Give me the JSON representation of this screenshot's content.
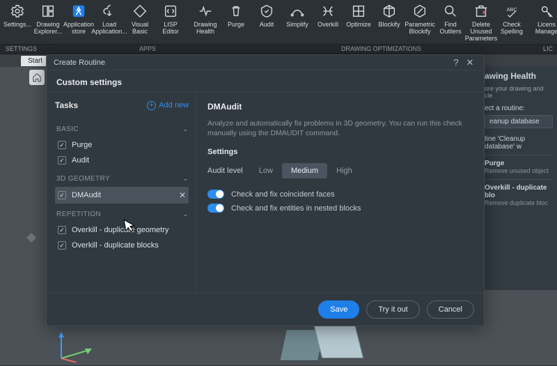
{
  "ribbon": {
    "items": [
      {
        "label": "Settings...",
        "icon": "gear"
      },
      {
        "label": "Drawing\nExplorer...",
        "icon": "explorer"
      },
      {
        "label": "Application\nstore",
        "icon": "appstore",
        "accent": "#1f7fe8"
      },
      {
        "label": "Load\nApplication...",
        "icon": "load"
      },
      {
        "label": "Visual\nBasic",
        "icon": "vba"
      },
      {
        "label": "LISP\nEditor",
        "icon": "lisp"
      },
      {
        "label": "Drawing\nHealth",
        "icon": "health"
      },
      {
        "label": "Purge",
        "icon": "purge"
      },
      {
        "label": "Audit",
        "icon": "audit"
      },
      {
        "label": "Simplify",
        "icon": "simplify"
      },
      {
        "label": "Overkill",
        "icon": "overkill"
      },
      {
        "label": "Optimize",
        "icon": "optimize"
      },
      {
        "label": "Blockify",
        "icon": "blockify"
      },
      {
        "label": "Parametric\nBlockify",
        "icon": "pblockify"
      },
      {
        "label": "Find\nOutliers",
        "icon": "outliers"
      },
      {
        "label": "Delete Unused\nParameters",
        "icon": "deleteparams"
      },
      {
        "label": "Check\nSpelling",
        "icon": "spell"
      },
      {
        "label": "Licens\nManage",
        "icon": "license"
      }
    ],
    "groups": {
      "settings": "SETTINGS",
      "apps": "APPS",
      "draw": "DRAWING OPTIMIZATIONS",
      "lic": "LIC"
    }
  },
  "tabs": {
    "start": "Start"
  },
  "rpanel": {
    "title": "awing Health",
    "sub": "ore your drawing and cle",
    "label": "ect a routine:",
    "combo": "eanup database",
    "routine": "tine 'Cleanup database' w",
    "sec1_title": "Purge",
    "sec1_sub": "Remove unused object",
    "sec2_title": "Overkill - duplicate blo",
    "sec2_sub": "Remove duplicate bloc"
  },
  "dialog": {
    "title": "Create Routine",
    "subtitle": "Custom settings",
    "tasks_title": "Tasks",
    "add_new": "Add new",
    "groups": {
      "basic": "BASIC",
      "geom": "3D GEOMETRY",
      "rep": "REPETITION"
    },
    "tasks": {
      "purge": "Purge",
      "audit": "Audit",
      "dmaudit": "DMAudit",
      "overkill_geom": "Overkill - duplicate geometry",
      "overkill_blocks": "Overkill - duplicate blocks"
    },
    "detail": {
      "title": "DMAudit",
      "desc": "Analyze and automatically fix problems in 3D geometry. You can run this check manually using the DMAUDIT command.",
      "settings": "Settings",
      "level_label": "Audit level",
      "levels": {
        "low": "Low",
        "med": "Medium",
        "high": "High"
      },
      "toggle1": "Check and fix coincident faces",
      "toggle2": "Check and fix entities in nested blocks"
    },
    "buttons": {
      "save": "Save",
      "try": "Try it out",
      "cancel": "Cancel"
    }
  }
}
